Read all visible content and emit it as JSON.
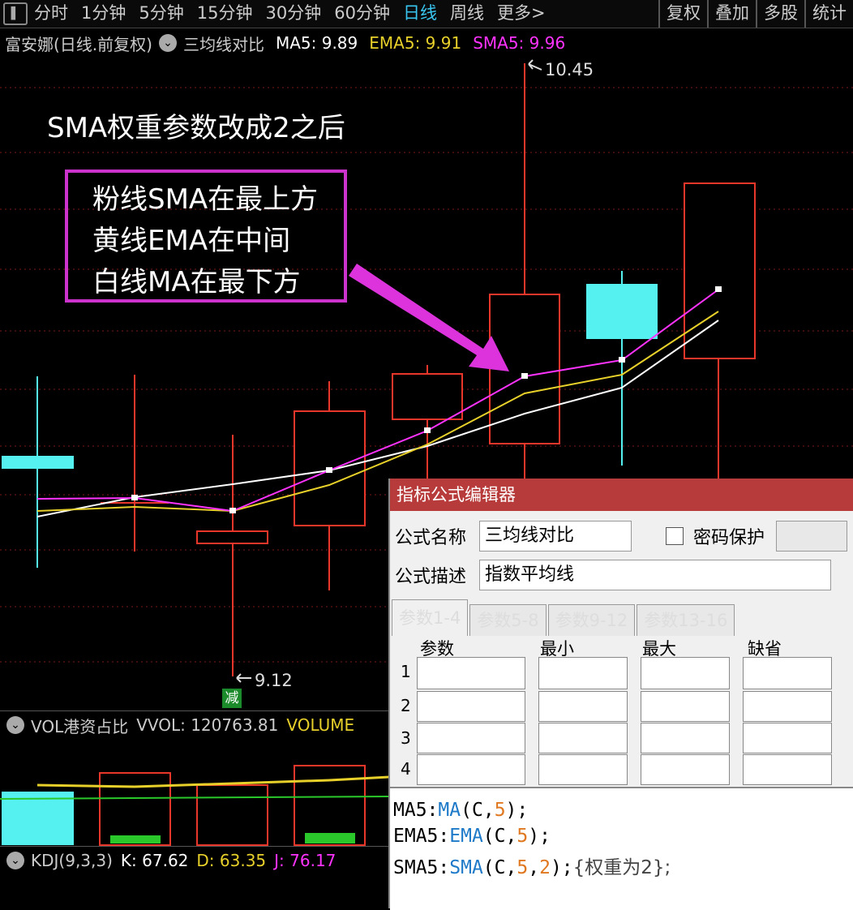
{
  "toolbar": {
    "items": [
      "分时",
      "1分钟",
      "5分钟",
      "15分钟",
      "30分钟",
      "60分钟",
      "日线",
      "周线",
      "更多>"
    ],
    "active_item": "日线",
    "right_items": [
      "复权",
      "叠加",
      "多股",
      "统计"
    ]
  },
  "infobar": {
    "title": "富安娜(日线.前复权)",
    "indicator": "三均线对比",
    "ma5": "MA5: 9.89",
    "ema5": "EMA5: 9.91",
    "sma5": "SMA5: 9.96"
  },
  "annotation": {
    "caption": "SMA权重参数改成2之后",
    "lines": [
      "粉线SMA在最上方",
      "黄线EMA在中间",
      "白线MA在最下方"
    ]
  },
  "price_labels": {
    "high": "10.45",
    "low": "9.12",
    "badge": "减"
  },
  "vol_bar": {
    "name": "VOL港资占比",
    "vvol": "VVOL: 120763.81",
    "volume": "VOLUME"
  },
  "kdj_bar": {
    "name": "KDJ(9,3,3)",
    "k": "K: 67.62",
    "d": "D: 63.35",
    "j": "J: 76.17"
  },
  "dialog": {
    "title": "指标公式编辑器",
    "name_label": "公式名称",
    "name_value": "三均线对比",
    "password_label": "密码保护",
    "desc_label": "公式描述",
    "desc_value": "指数平均线",
    "tabs": [
      "参数1-4",
      "参数5-8",
      "参数9-12",
      "参数13-16"
    ],
    "param_headers": [
      "参数",
      "最小",
      "最大",
      "缺省"
    ],
    "row_numbers": [
      "1",
      "2",
      "3",
      "4"
    ],
    "code": [
      {
        "id": "MA5",
        "sep": ":",
        "fn": "MA",
        "args": [
          "C",
          "5"
        ],
        "tail": ");"
      },
      {
        "id": "EMA5",
        "sep": ":",
        "fn": "EMA",
        "args": [
          "C",
          "5"
        ],
        "tail": ");"
      },
      {
        "id": "SMA5",
        "sep": ":",
        "fn": "SMA",
        "args": [
          "C",
          "5",
          "2"
        ],
        "tail": ");",
        "comment": "{权重为2};"
      }
    ]
  },
  "colors": {
    "ma": "#ffffff",
    "ema": "#e8d02a",
    "sma": "#ff33ff",
    "up": "#e8362a",
    "down": "#55f0f0"
  }
}
